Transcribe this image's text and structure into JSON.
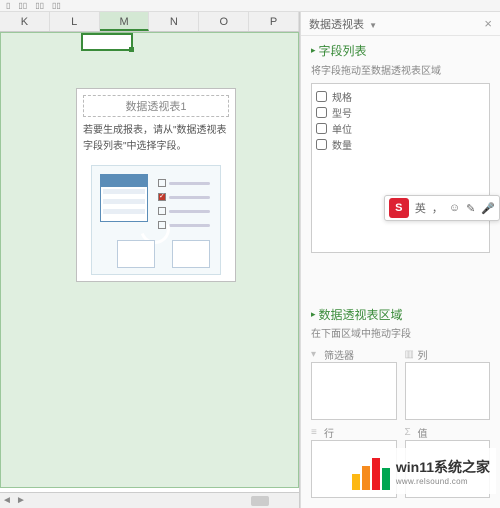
{
  "toolbar_hints": [
    "…",
    "…",
    "…",
    "…"
  ],
  "columns": [
    "K",
    "L",
    "M",
    "N",
    "O",
    "P"
  ],
  "active_column_index": 2,
  "pivot_placeholder": {
    "title": "数据透视表1",
    "message": "若要生成报表，请从\"数据透视表字段列表\"中选择字段。"
  },
  "panel": {
    "title": "数据透视表",
    "field_section": {
      "title": "字段列表",
      "subtitle": "将字段拖动至数据透视表区域",
      "fields": [
        "规格",
        "型号",
        "单位",
        "数量"
      ]
    },
    "zone_section": {
      "title": "数据透视表区域",
      "subtitle": "在下面区域中拖动字段",
      "zones": {
        "filter": "筛选器",
        "column": "列",
        "row": "行",
        "value": "值"
      }
    }
  },
  "ime_bar": {
    "mode": "英",
    "items": [
      "，",
      "☺",
      "✎",
      "🎤"
    ]
  },
  "watermark": {
    "line1": "win11系统之家",
    "line2": "www.relsound.com"
  }
}
